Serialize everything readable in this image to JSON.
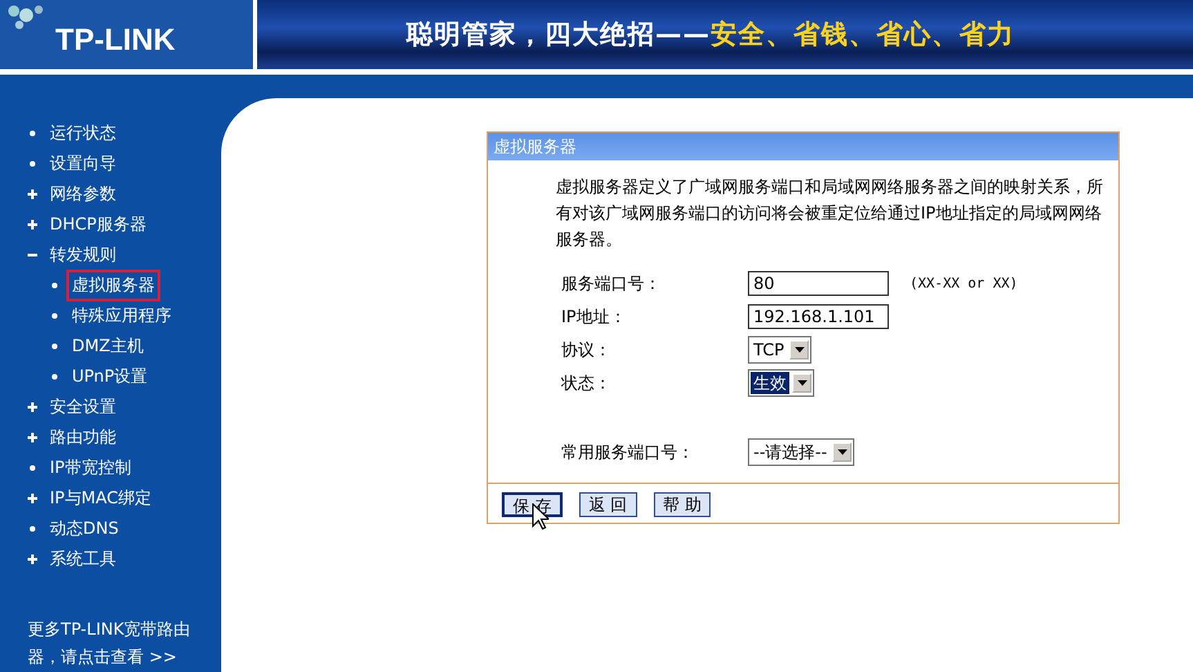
{
  "header": {
    "logo": "TP-LINK",
    "slogan": "聪明管家，四大绝招——",
    "slogan_highlight": "安全、省钱、省心、省力"
  },
  "sidebar": {
    "items": [
      {
        "label": "运行状态",
        "kind": "leaf",
        "selected": false
      },
      {
        "label": "设置向导",
        "kind": "leaf",
        "selected": false
      },
      {
        "label": "网络参数",
        "kind": "group",
        "expanded": false,
        "selected": false
      },
      {
        "label": "DHCP服务器",
        "kind": "group",
        "expanded": false,
        "selected": false
      },
      {
        "label": "转发规则",
        "kind": "group",
        "expanded": true,
        "selected": false,
        "children": [
          {
            "label": "虚拟服务器",
            "selected": true
          },
          {
            "label": "特殊应用程序",
            "selected": false
          },
          {
            "label": "DMZ主机",
            "selected": false
          },
          {
            "label": "UPnP设置",
            "selected": false
          }
        ]
      },
      {
        "label": "安全设置",
        "kind": "group",
        "expanded": false,
        "selected": false
      },
      {
        "label": "路由功能",
        "kind": "group",
        "expanded": false,
        "selected": false
      },
      {
        "label": "IP带宽控制",
        "kind": "leaf",
        "selected": false
      },
      {
        "label": "IP与MAC绑定",
        "kind": "group",
        "expanded": false,
        "selected": false
      },
      {
        "label": "动态DNS",
        "kind": "leaf",
        "selected": false
      },
      {
        "label": "系统工具",
        "kind": "group",
        "expanded": false,
        "selected": false
      }
    ],
    "footer": "更多TP-LINK宽带路由器，请点击查看 >>"
  },
  "panel": {
    "title": "虚拟服务器",
    "description": "虚拟服务器定义了广域网服务端口和局域网网络服务器之间的映射关系，所有对该广域网服务端口的访问将会被重定位给通过IP地址指定的局域网网络服务器。",
    "fields": [
      {
        "label": "服务端口号：",
        "kind": "input",
        "value": "80",
        "hint": "(XX-XX or XX)"
      },
      {
        "label": "IP地址：",
        "kind": "input",
        "value": "192.168.1.101"
      },
      {
        "label": "协议：",
        "kind": "select",
        "value": "TCP",
        "focused": false
      },
      {
        "label": "状态：",
        "kind": "select",
        "value": "生效",
        "focused": true
      },
      {
        "label": "常用服务端口号：",
        "kind": "select",
        "value": "--请选择--",
        "focused": false
      }
    ],
    "buttons": [
      {
        "label": "保 存",
        "pressed": true
      },
      {
        "label": "返 回",
        "pressed": false
      },
      {
        "label": "帮 助",
        "pressed": false
      }
    ]
  }
}
